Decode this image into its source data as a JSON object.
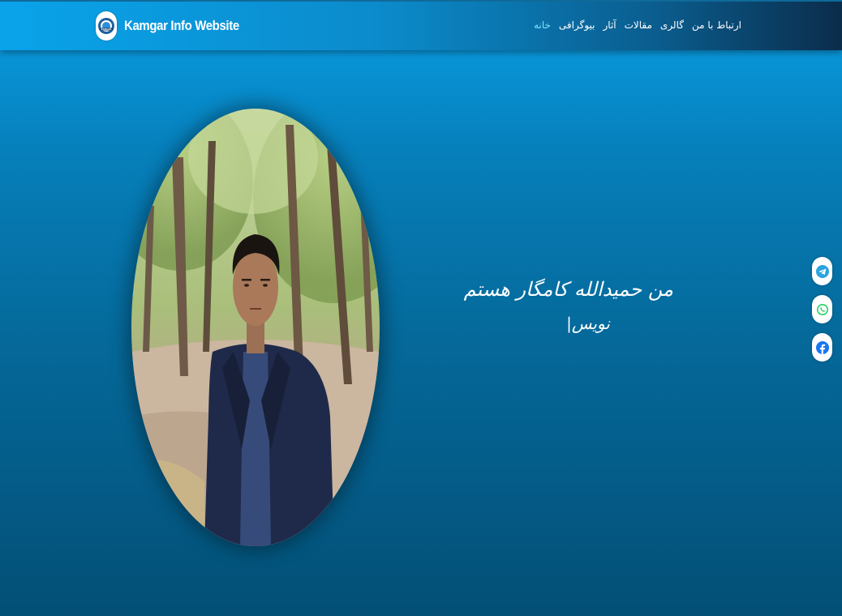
{
  "brand": {
    "title": "Kamgar Info Website",
    "logo_text": "KAMGAR",
    "logo_icon": "kamgar-logo"
  },
  "nav": {
    "items": [
      {
        "label": "خانه",
        "active": true
      },
      {
        "label": "بیوگرافی",
        "active": false
      },
      {
        "label": "آثار",
        "active": false
      },
      {
        "label": "مقالات",
        "active": false
      },
      {
        "label": "گالری",
        "active": false
      },
      {
        "label": "ارتباط با من",
        "active": false
      }
    ]
  },
  "hero": {
    "title": "من حمیدالله کامگار هستم",
    "subtitle": "نویس|",
    "photo": "profile-photo"
  },
  "social": [
    {
      "name": "telegram",
      "icon": "telegram-icon"
    },
    {
      "name": "whatsapp",
      "icon": "whatsapp-icon"
    },
    {
      "name": "facebook",
      "icon": "facebook-icon"
    }
  ],
  "colors": {
    "accent": "#7fe3ff",
    "nav_start": "#0aa3ea",
    "nav_end": "#0b2c4b",
    "bg_top": "#0a9fe6",
    "bg_bottom": "#034f76",
    "telegram": "#2aa3df",
    "whatsapp": "#25d366",
    "facebook": "#1877f2"
  }
}
